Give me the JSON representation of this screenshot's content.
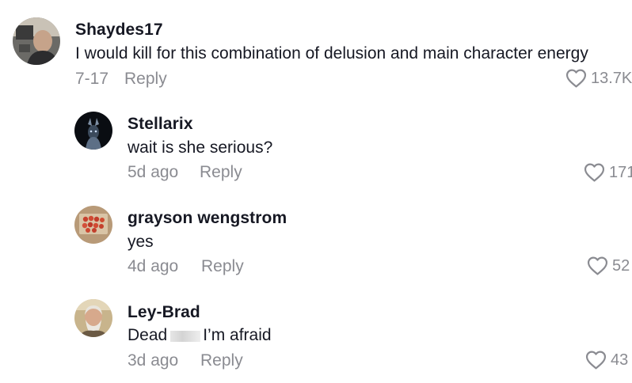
{
  "comments": [
    {
      "username": "Shaydes17",
      "text": "I would kill for this combination of delusion and main character energy",
      "date": "7-17",
      "reply_label": "Reply",
      "likes": "13.7K",
      "avatar_icon": "user-avatar-icon"
    },
    {
      "username": "Stellarix",
      "text": "wait is she serious?",
      "date": "5d ago",
      "reply_label": "Reply",
      "likes": "171",
      "avatar_icon": "user-avatar-icon"
    },
    {
      "username": "grayson wengstrom",
      "text": "yes",
      "date": "4d ago",
      "reply_label": "Reply",
      "likes": "52",
      "avatar_icon": "user-avatar-icon"
    },
    {
      "username": "Ley-Brad",
      "text_before": "Dead",
      "text_after": "I’m afraid",
      "date": "3d ago",
      "reply_label": "Reply",
      "likes": "43",
      "avatar_icon": "user-avatar-icon"
    }
  ],
  "colors": {
    "primary_text": "#161823",
    "secondary_text": "#8a8b91",
    "background": "#ffffff"
  },
  "icons": {
    "like": "heart-outline-icon"
  }
}
